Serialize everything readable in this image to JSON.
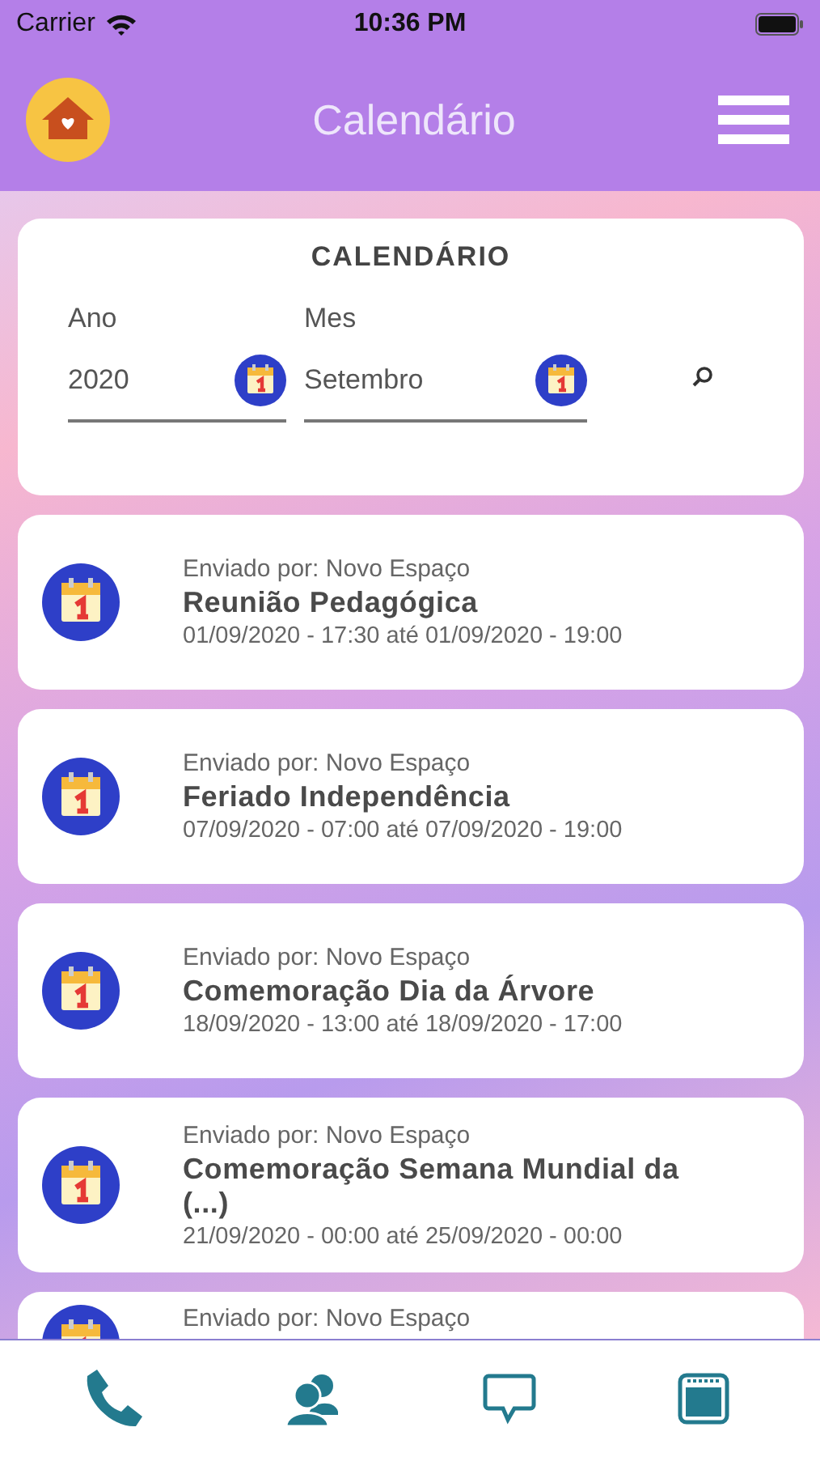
{
  "status_bar": {
    "carrier": "Carrier",
    "time": "10:36 PM"
  },
  "header": {
    "title": "Calendário"
  },
  "filter": {
    "title": "CALENDÁRIO",
    "fields": [
      {
        "label": "Ano",
        "value": "2020"
      },
      {
        "label": "Mes",
        "value": "Setembro"
      }
    ]
  },
  "events": [
    {
      "sender": "Enviado por: Novo Espaço",
      "title": "Reunião Pedagógica",
      "period": "01/09/2020 - 17:30 até 01/09/2020 - 19:00"
    },
    {
      "sender": "Enviado por: Novo Espaço",
      "title": "Feriado Independência",
      "period": "07/09/2020 - 07:00 até 07/09/2020 - 19:00"
    },
    {
      "sender": "Enviado por: Novo Espaço",
      "title": "Comemoração Dia da Árvore",
      "period": "18/09/2020 - 13:00 até 18/09/2020 - 17:00"
    },
    {
      "sender": "Enviado por: Novo Espaço",
      "title": "Comemoração Semana Mundial da (...)",
      "period": "21/09/2020 - 00:00 até 25/09/2020 - 00:00"
    },
    {
      "sender": "Enviado por: Novo Espaço"
    }
  ],
  "tab_bar": {
    "tabs": [
      {
        "kind": "phone"
      },
      {
        "kind": "contacts"
      },
      {
        "kind": "chat"
      },
      {
        "kind": "calendar"
      }
    ]
  }
}
